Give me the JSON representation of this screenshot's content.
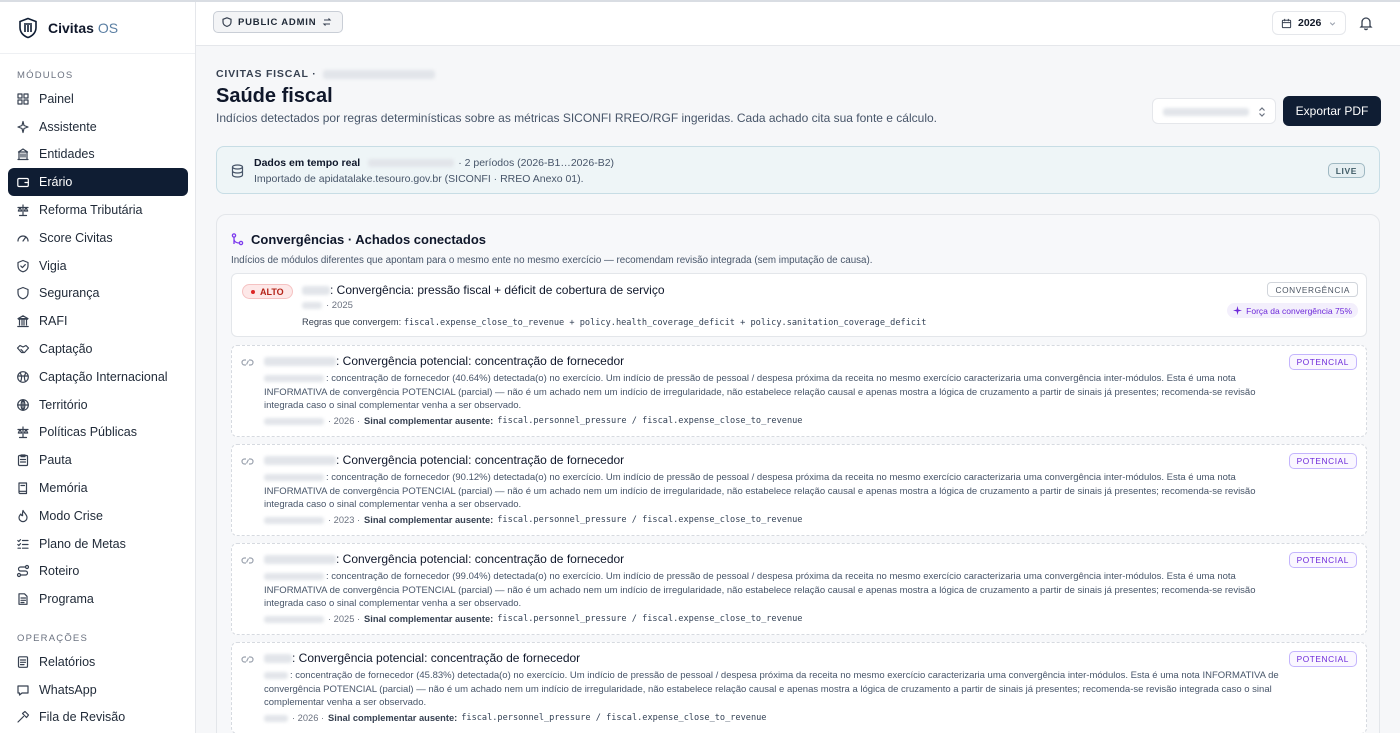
{
  "brand": {
    "name": "Civitas",
    "suffix": "OS"
  },
  "sidebar": {
    "modulos_label": "MÓDULOS",
    "operacoes_label": "OPERAÇÕES",
    "modulos": [
      {
        "label": "Painel",
        "icon": "grid-icon"
      },
      {
        "label": "Assistente",
        "icon": "sparkles-icon"
      },
      {
        "label": "Entidades",
        "icon": "building-icon"
      },
      {
        "label": "Erário",
        "icon": "wallet-icon",
        "active": true
      },
      {
        "label": "Reforma Tributária",
        "icon": "scale-icon"
      },
      {
        "label": "Score Civitas",
        "icon": "gauge-icon"
      },
      {
        "label": "Vigia",
        "icon": "shield-check-icon"
      },
      {
        "label": "Segurança",
        "icon": "shield-icon"
      },
      {
        "label": "RAFI",
        "icon": "landmark-icon"
      },
      {
        "label": "Captação",
        "icon": "handshake-icon"
      },
      {
        "label": "Captação Internacional",
        "icon": "globe-icon"
      },
      {
        "label": "Território",
        "icon": "globe-grid-icon"
      },
      {
        "label": "Políticas Públicas",
        "icon": "scale-icon"
      },
      {
        "label": "Pauta",
        "icon": "clipboard-icon"
      },
      {
        "label": "Memória",
        "icon": "book-icon"
      },
      {
        "label": "Modo Crise",
        "icon": "flame-icon"
      },
      {
        "label": "Plano de Metas",
        "icon": "list-check-icon"
      },
      {
        "label": "Roteiro",
        "icon": "route-icon"
      },
      {
        "label": "Programa",
        "icon": "document-icon"
      }
    ],
    "operacoes": [
      {
        "label": "Relatórios",
        "icon": "file-text-icon"
      },
      {
        "label": "WhatsApp",
        "icon": "chat-icon"
      },
      {
        "label": "Fila de Revisão",
        "icon": "hammer-icon"
      }
    ]
  },
  "topbar": {
    "admin_label": "PUBLIC ADMIN",
    "year": "2026"
  },
  "header": {
    "eyebrow": "CIVITAS FISCAL ·",
    "title": "Saúde fiscal",
    "subtitle": "Indícios detectados por regras determinísticas sobre as métricas SICONFI RREO/RGF ingeridas. Cada achado cita sua fonte e cálculo.",
    "export_label": "Exportar PDF"
  },
  "live": {
    "title": "Dados em tempo real",
    "periods": "· 2 períodos (2026-B1…2026-B2)",
    "source": "Importado de apidatalake.tesouro.gov.br (SICONFI · RREO Anexo 01).",
    "badge": "LIVE"
  },
  "convergencias": {
    "title": "Convergências · Achados conectados",
    "description": "Indícios de módulos diferentes que apontam para o mesmo ente no mesmo exercício — recomendam revisão integrada (sem imputação de causa).",
    "main_card": {
      "severity": "ALTO",
      "title": ": Convergência: pressão fiscal + déficit de cobertura de serviço",
      "year": "· 2025",
      "rules_label": "Regras que convergem:",
      "rules": "fiscal.expense_close_to_revenue + policy.health_coverage_deficit + policy.sanitation_coverage_deficit",
      "tag": "CONVERGÊNCIA",
      "strength": "Força da convergência 75%"
    },
    "potential_cards": [
      {
        "title": ": Convergência potencial: concentração de fornecedor",
        "lead": ": concentração de fornecedor (40.64%) detectada(o) no exercício. Um indício de pressão de pessoal / despesa próxima da receita no mesmo exercício caracterizaria uma convergência inter-módulos. Esta é uma nota INFORMATIVA de convergência POTENCIAL (parcial) — não é um achado nem um indício de irregularidade, não estabelece relação causal e apenas mostra a lógica de cruzamento a partir de sinais já presentes; recomenda-se revisão integrada caso o sinal complementar venha a ser observado.",
        "year": "· 2026 ·",
        "missing_label": "Sinal complementar ausente:",
        "missing": "fiscal.personnel_pressure / fiscal.expense_close_to_revenue",
        "tag": "POTENCIAL"
      },
      {
        "title": ": Convergência potencial: concentração de fornecedor",
        "lead": ": concentração de fornecedor (90.12%) detectada(o) no exercício. Um indício de pressão de pessoal / despesa próxima da receita no mesmo exercício caracterizaria uma convergência inter-módulos. Esta é uma nota INFORMATIVA de convergência POTENCIAL (parcial) — não é um achado nem um indício de irregularidade, não estabelece relação causal e apenas mostra a lógica de cruzamento a partir de sinais já presentes; recomenda-se revisão integrada caso o sinal complementar venha a ser observado.",
        "year": "· 2023 ·",
        "missing_label": "Sinal complementar ausente:",
        "missing": "fiscal.personnel_pressure / fiscal.expense_close_to_revenue",
        "tag": "POTENCIAL"
      },
      {
        "title": ": Convergência potencial: concentração de fornecedor",
        "lead": ": concentração de fornecedor (99.04%) detectada(o) no exercício. Um indício de pressão de pessoal / despesa próxima da receita no mesmo exercício caracterizaria uma convergência inter-módulos. Esta é uma nota INFORMATIVA de convergência POTENCIAL (parcial) — não é um achado nem um indício de irregularidade, não estabelece relação causal e apenas mostra a lógica de cruzamento a partir de sinais já presentes; recomenda-se revisão integrada caso o sinal complementar venha a ser observado.",
        "year": "· 2025 ·",
        "missing_label": "Sinal complementar ausente:",
        "missing": "fiscal.personnel_pressure / fiscal.expense_close_to_revenue",
        "tag": "POTENCIAL"
      },
      {
        "title": ": Convergência potencial: concentração de fornecedor",
        "lead": ": concentração de fornecedor (45.83%) detectada(o) no exercício. Um indício de pressão de pessoal / despesa próxima da receita no mesmo exercício caracterizaria uma convergência inter-módulos. Esta é uma nota INFORMATIVA de convergência POTENCIAL (parcial) — não é um achado nem um indício de irregularidade, não estabelece relação causal e apenas mostra a lógica de cruzamento a partir de sinais já presentes; recomenda-se revisão integrada caso o sinal complementar venha a ser observado.",
        "year": "· 2026 ·",
        "missing_label": "Sinal complementar ausente:",
        "missing": "fiscal.personnel_pressure / fiscal.expense_close_to_revenue",
        "tag": "POTENCIAL"
      }
    ]
  }
}
